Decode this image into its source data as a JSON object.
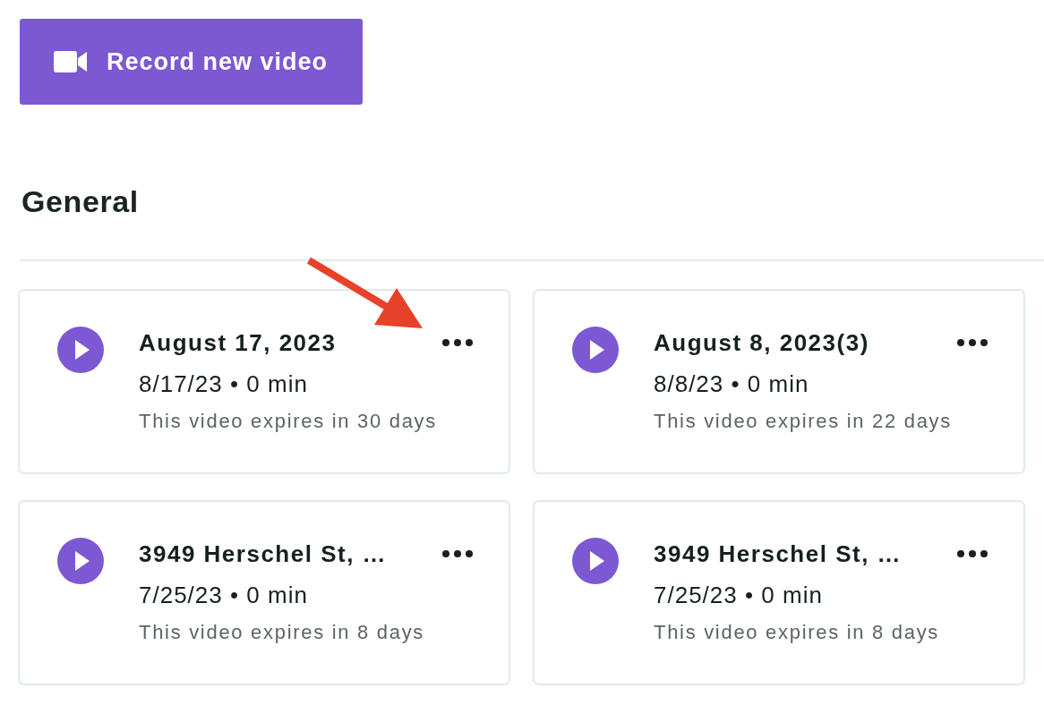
{
  "record_button": {
    "label": "Record new video"
  },
  "section": {
    "title": "General",
    "videos": [
      {
        "title": "August 17, 2023",
        "meta": "8/17/23 • 0 min",
        "expiry": "This video expires in 30 days",
        "annotated": true
      },
      {
        "title": "August 8, 2023(3)",
        "meta": "8/8/23 • 0 min",
        "expiry": "This video expires in 22 days",
        "annotated": false
      },
      {
        "title": "3949 Herschel St, …",
        "meta": "7/25/23 • 0 min",
        "expiry": "This video expires in 8 days",
        "annotated": false
      },
      {
        "title": "3949 Herschel St, …",
        "meta": "7/25/23 • 0 min",
        "expiry": "This video expires in 8 days",
        "annotated": false
      }
    ]
  }
}
